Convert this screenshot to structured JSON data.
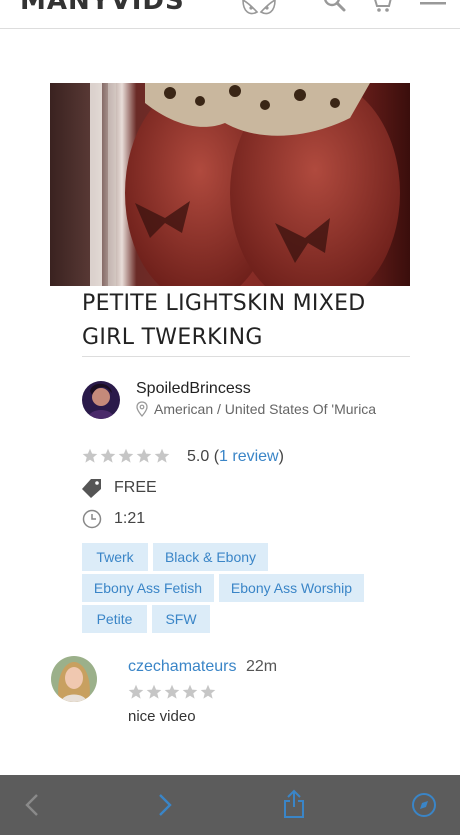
{
  "header": {
    "logo": "MANYVIDS",
    "icons": [
      "mv-mascot-icon",
      "search-icon",
      "cart-icon",
      "menu-icon"
    ]
  },
  "video": {
    "title": "PETITE LIGHTSKIN MIXED GIRL TWERKING"
  },
  "creator": {
    "name": "SpoiledBrincess",
    "location": "American / United States Of 'Murica"
  },
  "rating": {
    "stars": 5,
    "score": "5.0",
    "open_paren": "(",
    "reviews_link": "1 review",
    "close_paren": ")"
  },
  "price": "FREE",
  "duration": "1:21",
  "tags": [
    "Twerk",
    "Black & Ebony",
    "Ebony Ass Fetish",
    "Ebony Ass Worship",
    "Petite",
    "SFW"
  ],
  "review": {
    "user": "czechamateurs",
    "time": "22m",
    "stars": 5,
    "text": "nice video"
  },
  "browser_bar": {
    "icons": [
      "back-icon",
      "forward-icon",
      "share-icon",
      "compass-icon"
    ]
  },
  "colors": {
    "accent": "#3a85c7",
    "tag_bg": "#dcecf8",
    "toolbar": "#5c5c5c",
    "star": "#c6c6c6"
  }
}
